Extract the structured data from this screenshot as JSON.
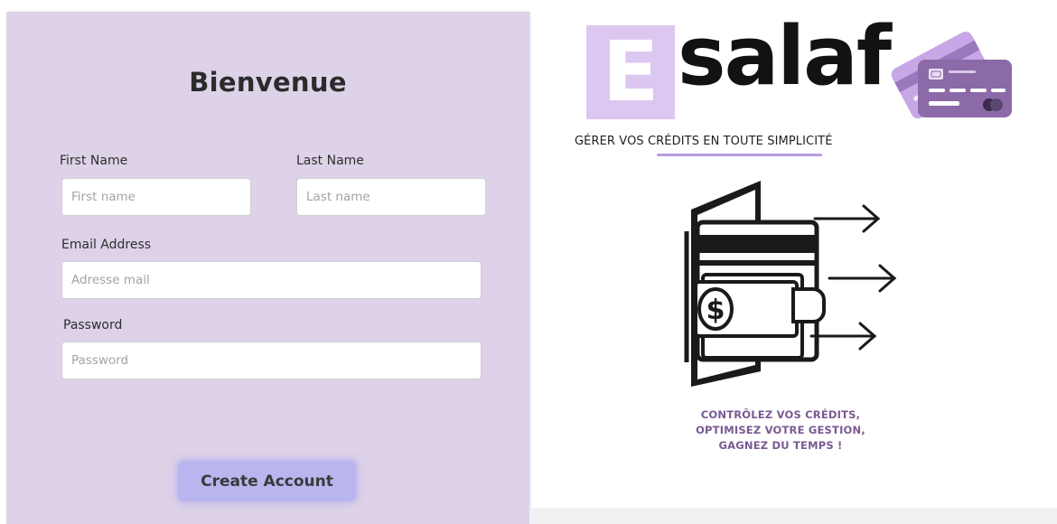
{
  "form": {
    "title": "Bienvenue",
    "first_name_label": "First Name",
    "first_name_placeholder": "First name",
    "last_name_label": "Last Name",
    "last_name_placeholder": "Last name",
    "email_label": "Email Address",
    "email_placeholder": "Adresse mail",
    "password_label": "Password",
    "password_placeholder": "Password",
    "submit_label": "Create Account"
  },
  "brand": {
    "logo_letter": "E",
    "logo_word": "salaf",
    "tagline": "GÉRER VOS CRÉDITS EN TOUTE SIMPLICITÉ",
    "slogan_line1": "CONTRÔLEZ VOS CRÉDITS,",
    "slogan_line2": "OPTIMISEZ VOTRE GESTION,",
    "slogan_line3": "GAGNEZ DU TEMPS !",
    "logo_icon": "credit-card-icon",
    "illustration_icon": "wallet-money-icon"
  },
  "colors": {
    "panel_bg": "#ddd2e8",
    "button_bg": "#b9b5ef",
    "logo_accent": "#dcc7f0",
    "slogan_color": "#7a5a92"
  }
}
